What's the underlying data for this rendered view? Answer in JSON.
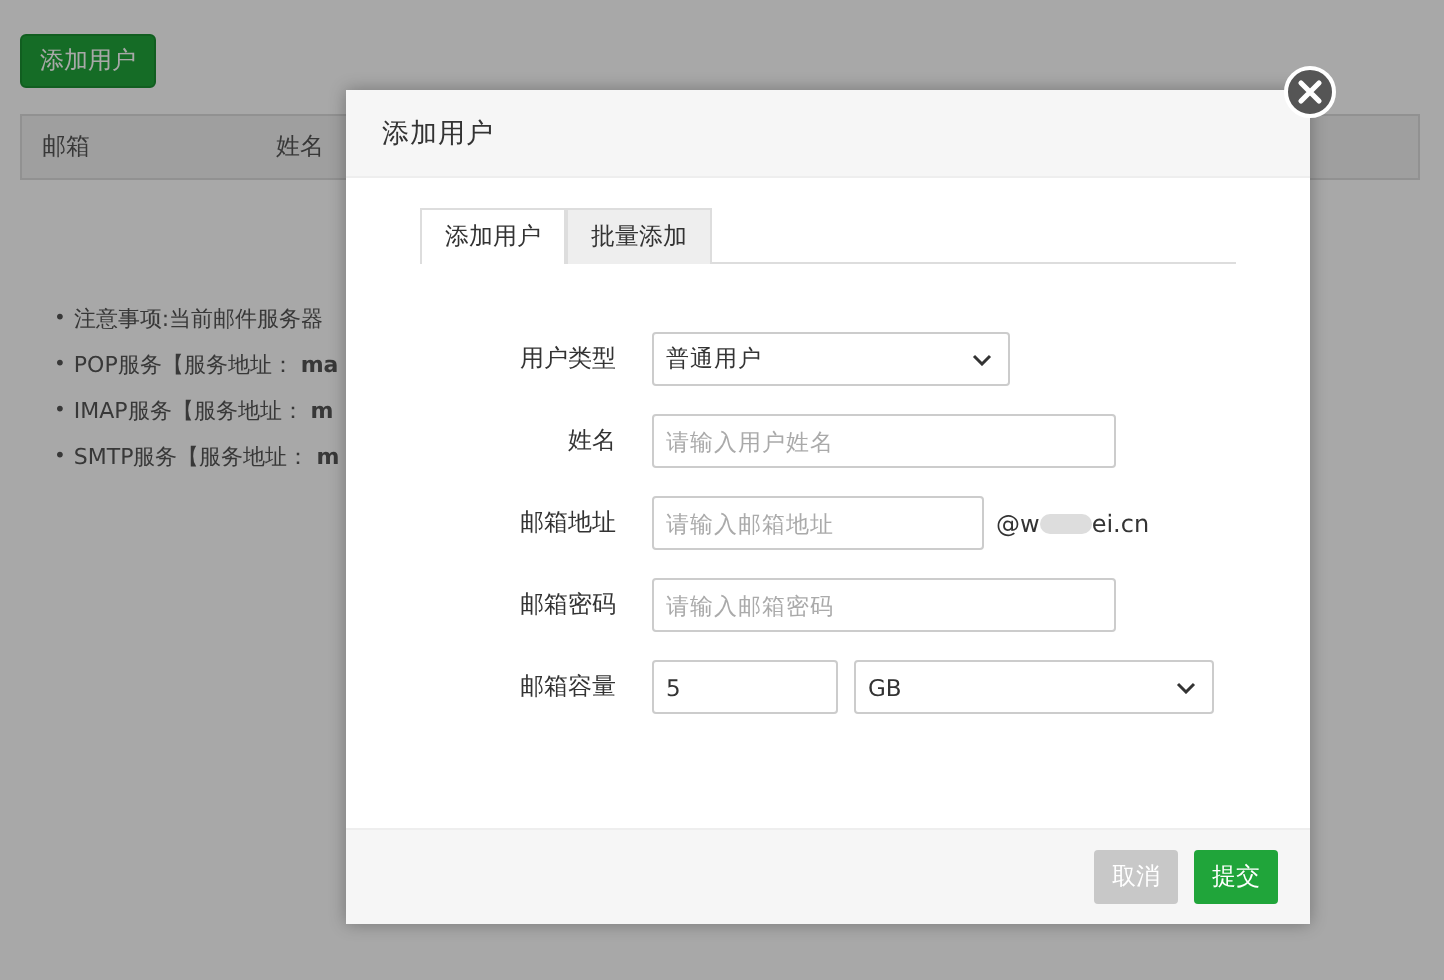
{
  "page": {
    "add_button": "添加用户",
    "table": {
      "columns": [
        "邮箱",
        "姓名"
      ]
    },
    "notes": [
      {
        "bullet": "•",
        "text": "注意事项:当前邮件服务器"
      },
      {
        "bullet": "•",
        "text": "POP服务【服务地址： **ma**"
      },
      {
        "bullet": "•",
        "text": "IMAP服务【服务地址： **m**"
      },
      {
        "bullet": "•",
        "text": "SMTP服务【服务地址： **m**"
      }
    ]
  },
  "dialog": {
    "title": "添加用户",
    "tabs": [
      {
        "label": "添加用户",
        "selected": true
      },
      {
        "label": "批量添加",
        "selected": false
      }
    ],
    "fields": [
      {
        "kind": "select",
        "label": "用户类型",
        "value": "普通用户"
      },
      {
        "kind": "input",
        "label": "姓名",
        "placeholder": "请输入用户姓名"
      },
      {
        "kind": "email",
        "label": "邮箱地址",
        "placeholder": "请输入邮箱地址",
        "domain_start": "@w",
        "domain_end": "ei.cn"
      },
      {
        "kind": "input",
        "label": "邮箱密码",
        "placeholder": "请输入邮箱密码"
      },
      {
        "kind": "quota",
        "label": "邮箱容量",
        "value": "5",
        "unit": "GB"
      }
    ],
    "buttons": [
      {
        "label": "取消",
        "kind": "cancel"
      },
      {
        "label": "提交",
        "kind": "submit"
      }
    ]
  }
}
